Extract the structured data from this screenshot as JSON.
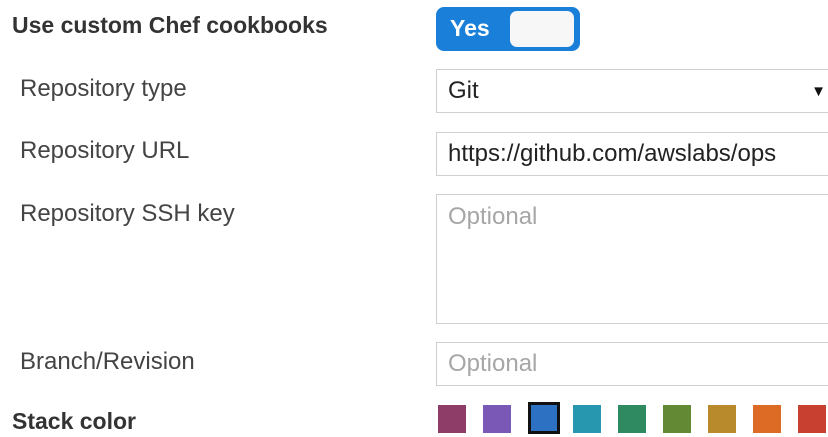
{
  "custom_cookbooks": {
    "label": "Use custom Chef cookbooks",
    "toggle_value": "Yes"
  },
  "repository_type": {
    "label": "Repository type",
    "value": "Git",
    "arrow": "▼"
  },
  "repository_url": {
    "label": "Repository URL",
    "value": "https://github.com/awslabs/ops"
  },
  "repository_ssh_key": {
    "label": "Repository SSH key",
    "placeholder": "Optional"
  },
  "branch_revision": {
    "label": "Branch/Revision",
    "placeholder": "Optional"
  },
  "stack_color": {
    "label": "Stack color",
    "colors": [
      "#8e3d68",
      "#7a59b6",
      "#2d72c2",
      "#2797b0",
      "#2f8a62",
      "#648934",
      "#b88a2c",
      "#dd6b25",
      "#c8402f"
    ],
    "selected_index": 2
  },
  "colors": {
    "toggle_on": "#1a7fd8",
    "field_border": "#cfcfcf",
    "placeholder": "#a6a6a6"
  }
}
